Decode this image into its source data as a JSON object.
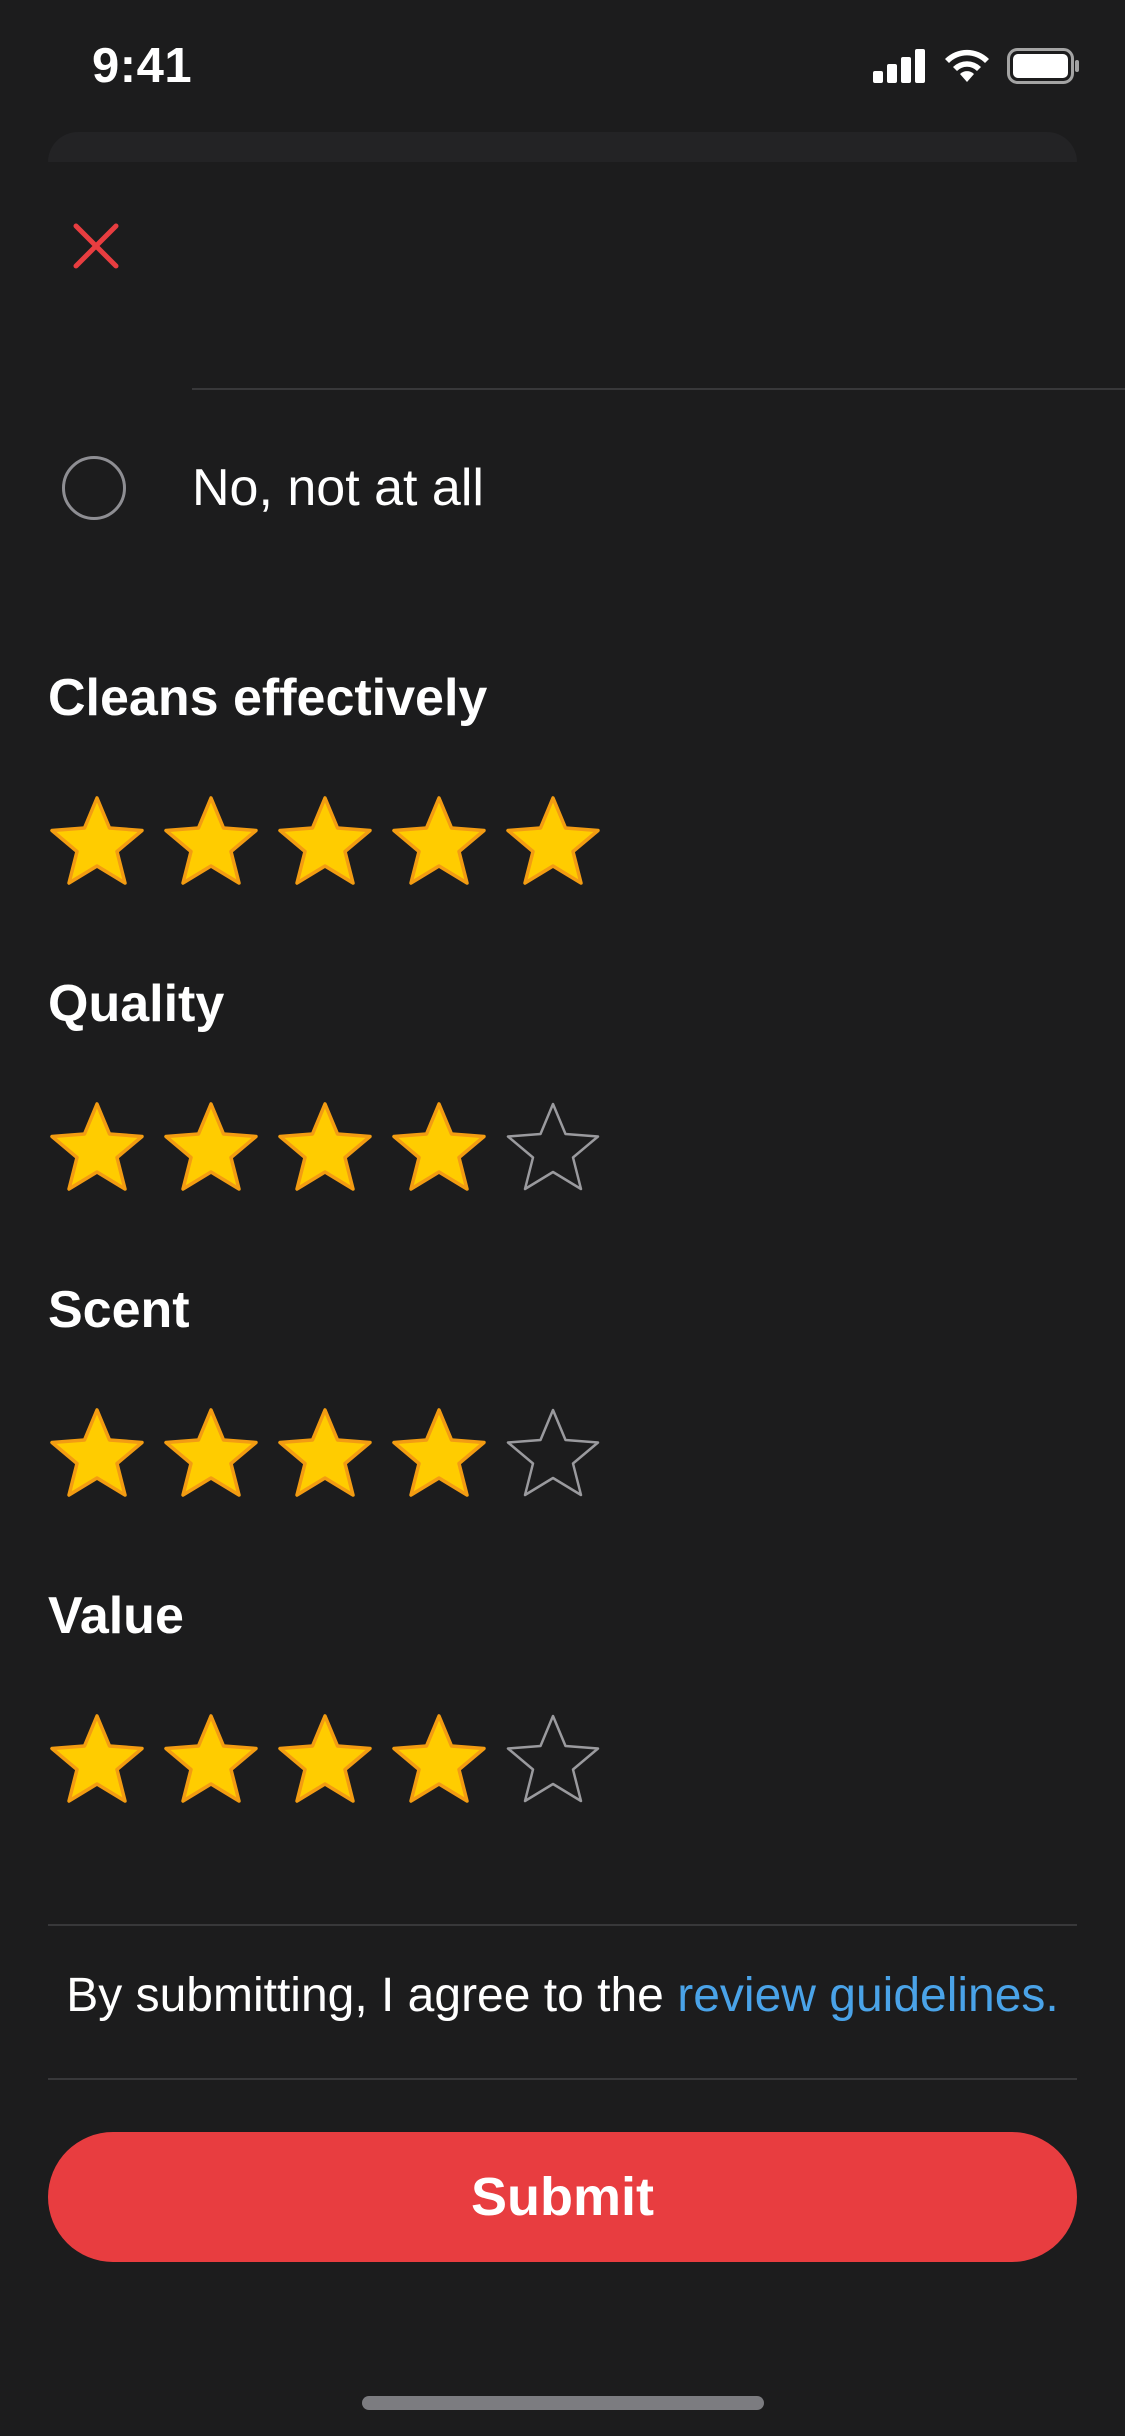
{
  "status_bar": {
    "time": "9:41"
  },
  "colors": {
    "background": "#1c1c1d",
    "accent": "#e83d40",
    "star_fill": "#ffcc00",
    "star_stroke": "#f39c12",
    "link": "#4aa3e8"
  },
  "question": {
    "option_label": "No, not at all"
  },
  "ratings": [
    {
      "label": "Cleans effectively",
      "value": 5,
      "max": 5
    },
    {
      "label": "Quality",
      "value": 4,
      "max": 5
    },
    {
      "label": "Scent",
      "value": 4,
      "max": 5
    },
    {
      "label": "Value",
      "value": 4,
      "max": 5
    }
  ],
  "footer": {
    "agree_prefix": "By submitting, I agree to the ",
    "agree_link": "review guidelines.",
    "submit_label": "Submit"
  },
  "icons": {
    "close": "close-icon",
    "star_filled": "star-filled-icon",
    "star_empty": "star-empty-icon"
  }
}
